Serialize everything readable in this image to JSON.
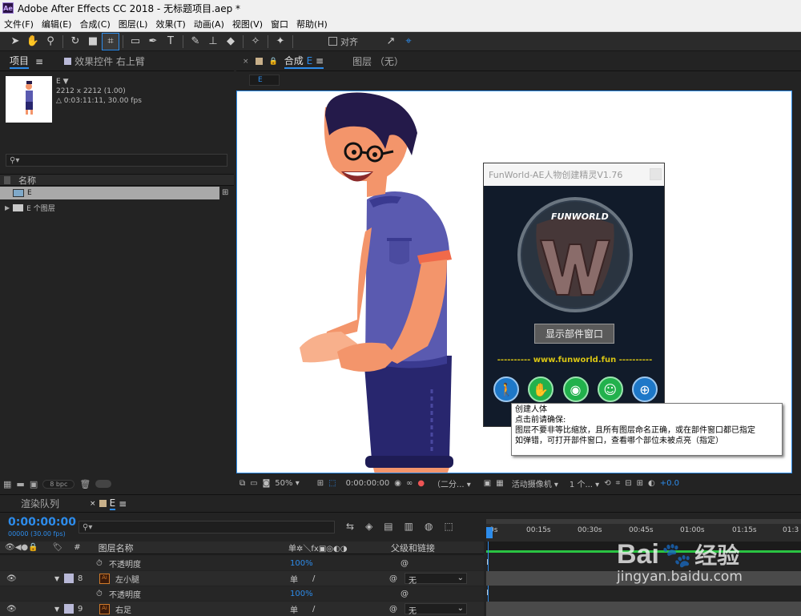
{
  "titlebar": {
    "logo": "Ae",
    "title": "Adobe After Effects CC 2018 - 无标题项目.aep *"
  },
  "menu": [
    "文件(F)",
    "编辑(E)",
    "合成(C)",
    "图层(L)",
    "效果(T)",
    "动画(A)",
    "视图(V)",
    "窗口",
    "帮助(H)"
  ],
  "toolbar": {
    "snap_label": "对齐"
  },
  "project_panel": {
    "tab_project": "项目",
    "tab_menu": "≡",
    "tab_effects": "效果控件 右上臂",
    "comp_name": "E",
    "comp_dims": "2212 x 2212 (1.00)",
    "comp_duration": "△ 0:03:11:11, 30.00 fps",
    "search_placeholder": "",
    "col_name": "名称",
    "items": [
      {
        "name": "E",
        "selected": true,
        "type": "comp"
      },
      {
        "name": "E 个图层",
        "selected": false,
        "type": "folder"
      }
    ],
    "bpc": "8 bpc"
  },
  "comp_panel": {
    "tab_comp": "合成",
    "tab_comp_name": "E",
    "tab_layer": "图层 （无）",
    "breadcrumb": "E",
    "zoom": "50%",
    "timecode": "0:00:00:00",
    "resolution": "（二分...",
    "camera": "活动摄像机",
    "views": "1 个...",
    "exposure": "+0.0"
  },
  "plugin": {
    "title": "FunWorld-AE人物创建精灵V1.76",
    "logo_text": "FUNWORLD",
    "logo_letter": "W",
    "show_parts_button": "显示部件窗口",
    "url": "---------- www.funworld.fun ----------",
    "buttons": [
      {
        "icon": "person-icon",
        "color": "#1e78c8"
      },
      {
        "icon": "hand-icon",
        "color": "#22b14c"
      },
      {
        "icon": "eye-icon",
        "color": "#22b14c"
      },
      {
        "icon": "user-check-icon",
        "color": "#22b14c"
      },
      {
        "icon": "target-icon",
        "color": "#1e78c8"
      }
    ]
  },
  "tooltip": {
    "line1": "创建人体",
    "line2": "点击前请确保:",
    "line3": "图层不要非等比缩放，且所有图层命名正确，或在部件窗口都已指定",
    "line4": "如弹错，可打开部件窗口，查看哪个部位未被点亮（指定）"
  },
  "timeline": {
    "tab_render": "渲染队列",
    "tab_comp": "E",
    "timecode": "0:00:00:00",
    "frames": "00000 (30.00 fps)",
    "col_layer_name": "图层名称",
    "col_switches": "单✲＼fx▣◎◐◑",
    "col_parent": "父级和链接",
    "col_hash": "#",
    "ruler": [
      "0s",
      "00:15s",
      "00:30s",
      "00:45s",
      "01:00s",
      "01:15s",
      "01:3"
    ],
    "rows": [
      {
        "kind": "prop",
        "label": "不透明度",
        "value": "100%"
      },
      {
        "kind": "layer",
        "num": "8",
        "name": "左小腿",
        "parent": "无"
      },
      {
        "kind": "prop",
        "label": "不透明度",
        "value": "100%"
      },
      {
        "kind": "layer",
        "num": "9",
        "name": "右足",
        "parent": "无"
      }
    ]
  },
  "watermark": {
    "brand": "Bai",
    "brand2": "经验",
    "url": "jingyan.baidu.com"
  }
}
